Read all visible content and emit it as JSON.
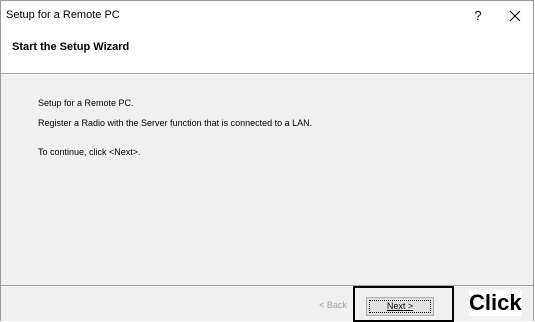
{
  "window": {
    "title": "Setup for a Remote PC",
    "help_glyph": "?",
    "close_icon": "close-icon"
  },
  "header": {
    "title": "Start the Setup Wizard"
  },
  "body": {
    "lines": [
      "Setup for a Remote PC.",
      "Register a Radio with the Server function that is connected to a LAN.",
      "To continue, click <Next>."
    ]
  },
  "footer": {
    "back_label": "< Back",
    "next_label": "Next >"
  },
  "annotation": {
    "label": "Click"
  },
  "colors": {
    "body_background": "#f0f0f0",
    "disabled_text": "#a0a0a0",
    "button_face": "#e1e1e1"
  }
}
